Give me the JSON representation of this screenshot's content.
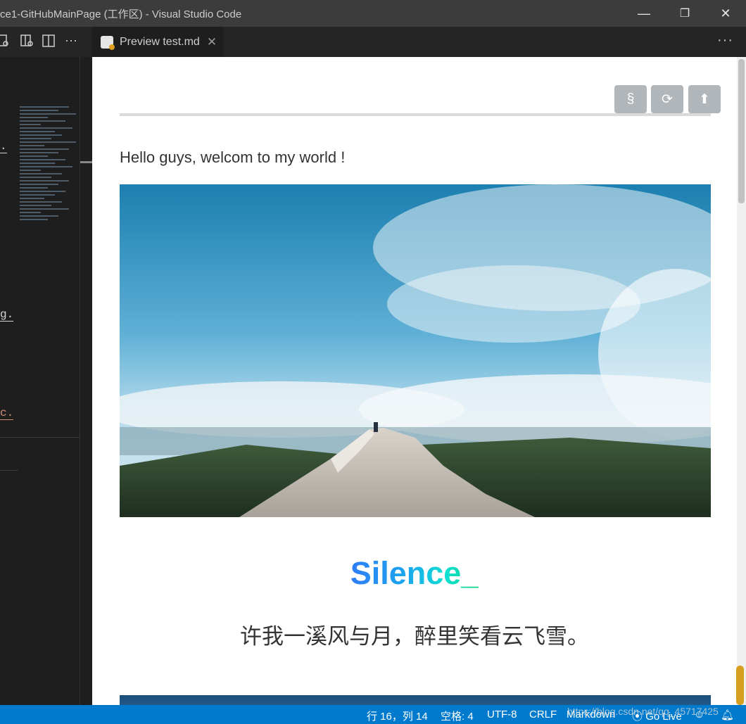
{
  "window": {
    "title": "ce1-GitHubMainPage (工作区) - Visual Studio Code",
    "controls": {
      "minimize": "—",
      "restore": "❐",
      "close": "✕"
    }
  },
  "editor_tab": {
    "label": "Preview test.md",
    "close": "✕",
    "more": "···"
  },
  "left_pane": {
    "more": "···",
    "code_fragments": [
      ".",
      "g.",
      "c."
    ]
  },
  "preview": {
    "buttons": {
      "section": "§",
      "refresh": "⟳",
      "top": "⬆"
    },
    "hello_text": "Hello guys, welcom to my world !",
    "brand": "Silence_",
    "tagline": "许我一溪风与月，醉里笑看云飞雪。"
  },
  "statusbar": {
    "position": "行 16，列 14",
    "indent": "空格: 4",
    "encoding": "UTF-8",
    "eol": "CRLF",
    "language": "Markdown",
    "golive": "Go Live"
  },
  "watermark": "https://blog.csdn.net/qq_45717425",
  "colors": {
    "statusbar": "#007acc",
    "titlebar": "#3c3c3c",
    "accent_gradient": [
      "#2e7df6",
      "#0fe0d2",
      "#10d080"
    ]
  }
}
